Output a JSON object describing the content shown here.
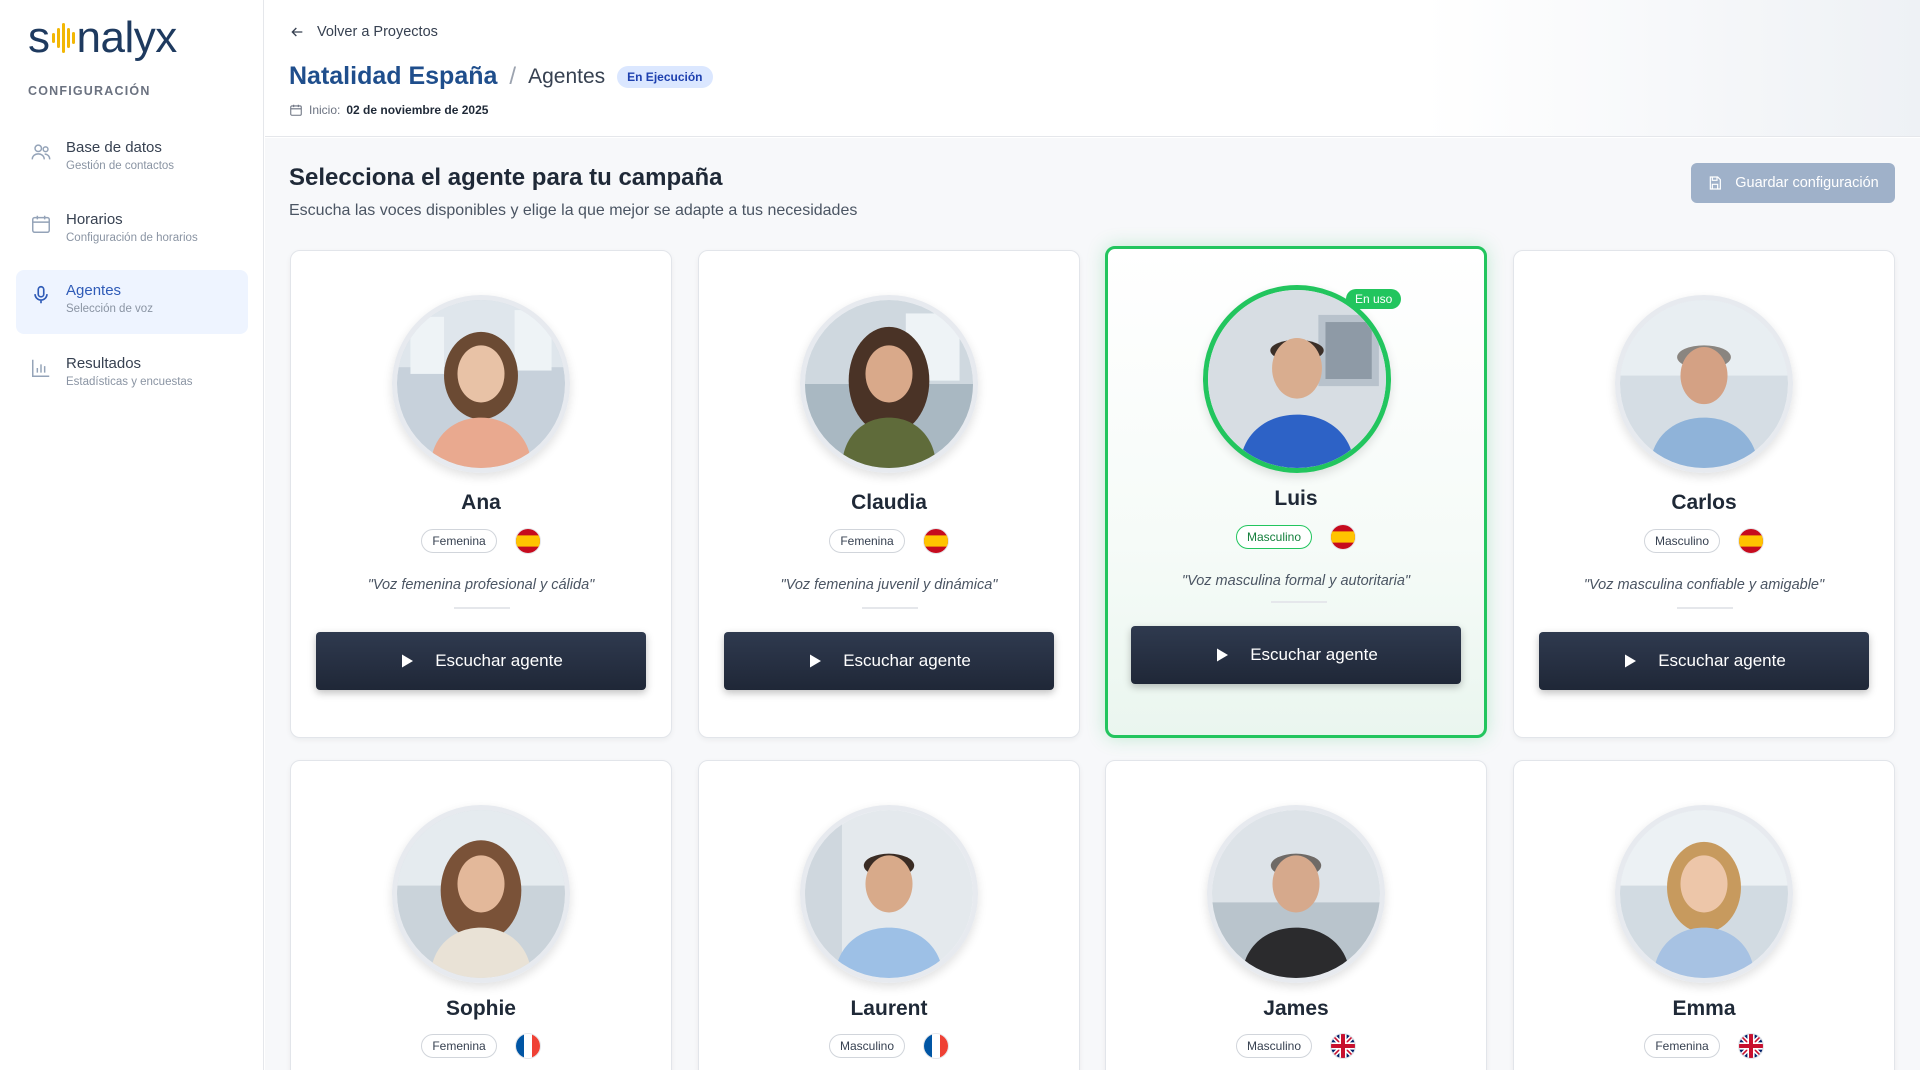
{
  "brand": {
    "logo_left": "s",
    "logo_right": "nalyx"
  },
  "sidebar": {
    "section": "CONFIGURACIÓN",
    "items": [
      {
        "label": "Base de datos",
        "sub": "Gestión de contactos",
        "icon": "users-icon"
      },
      {
        "label": "Horarios",
        "sub": "Configuración de horarios",
        "icon": "calendar-icon"
      },
      {
        "label": "Agentes",
        "sub": "Selección de voz",
        "icon": "microphone-icon",
        "active": true
      },
      {
        "label": "Resultados",
        "sub": "Estadísticas y encuestas",
        "icon": "bar-chart-icon"
      }
    ]
  },
  "header": {
    "back": "Volver a Proyectos",
    "project": "Natalidad España",
    "separator": "/",
    "page": "Agentes",
    "status": "En Ejecución",
    "start_label": "Inicio:",
    "start_date": "02 de noviembre de 2025"
  },
  "main": {
    "title": "Selecciona el agente para tu campaña",
    "subtitle": "Escucha las voces disponibles y elige la que mejor se adapte a tus necesidades",
    "save": "Guardar configuración",
    "play_label": "Escuchar agente",
    "in_use": "En uso"
  },
  "agents": [
    {
      "name": "Ana",
      "gender": "Femenina",
      "flag": "spain-flag-icon",
      "quote": "\"Voz femenina profesional y cálida\""
    },
    {
      "name": "Claudia",
      "gender": "Femenina",
      "flag": "spain-flag-icon",
      "quote": "\"Voz femenina juvenil y dinámica\""
    },
    {
      "name": "Luis",
      "gender": "Masculino",
      "flag": "spain-flag-icon",
      "quote": "\"Voz masculina formal y autoritaria\"",
      "selected": true
    },
    {
      "name": "Carlos",
      "gender": "Masculino",
      "flag": "spain-flag-icon",
      "quote": "\"Voz masculina confiable y amigable\""
    },
    {
      "name": "Sophie",
      "gender": "Femenina",
      "flag": "france-flag-icon"
    },
    {
      "name": "Laurent",
      "gender": "Masculino",
      "flag": "france-flag-icon"
    },
    {
      "name": "James",
      "gender": "Masculino",
      "flag": "uk-flag-icon"
    },
    {
      "name": "Emma",
      "gender": "Femenina",
      "flag": "uk-flag-icon"
    }
  ],
  "colors": {
    "brand": "#1e3a5f",
    "accent": "#f2b705",
    "selected": "#22c55e",
    "button": "#1f2737"
  }
}
